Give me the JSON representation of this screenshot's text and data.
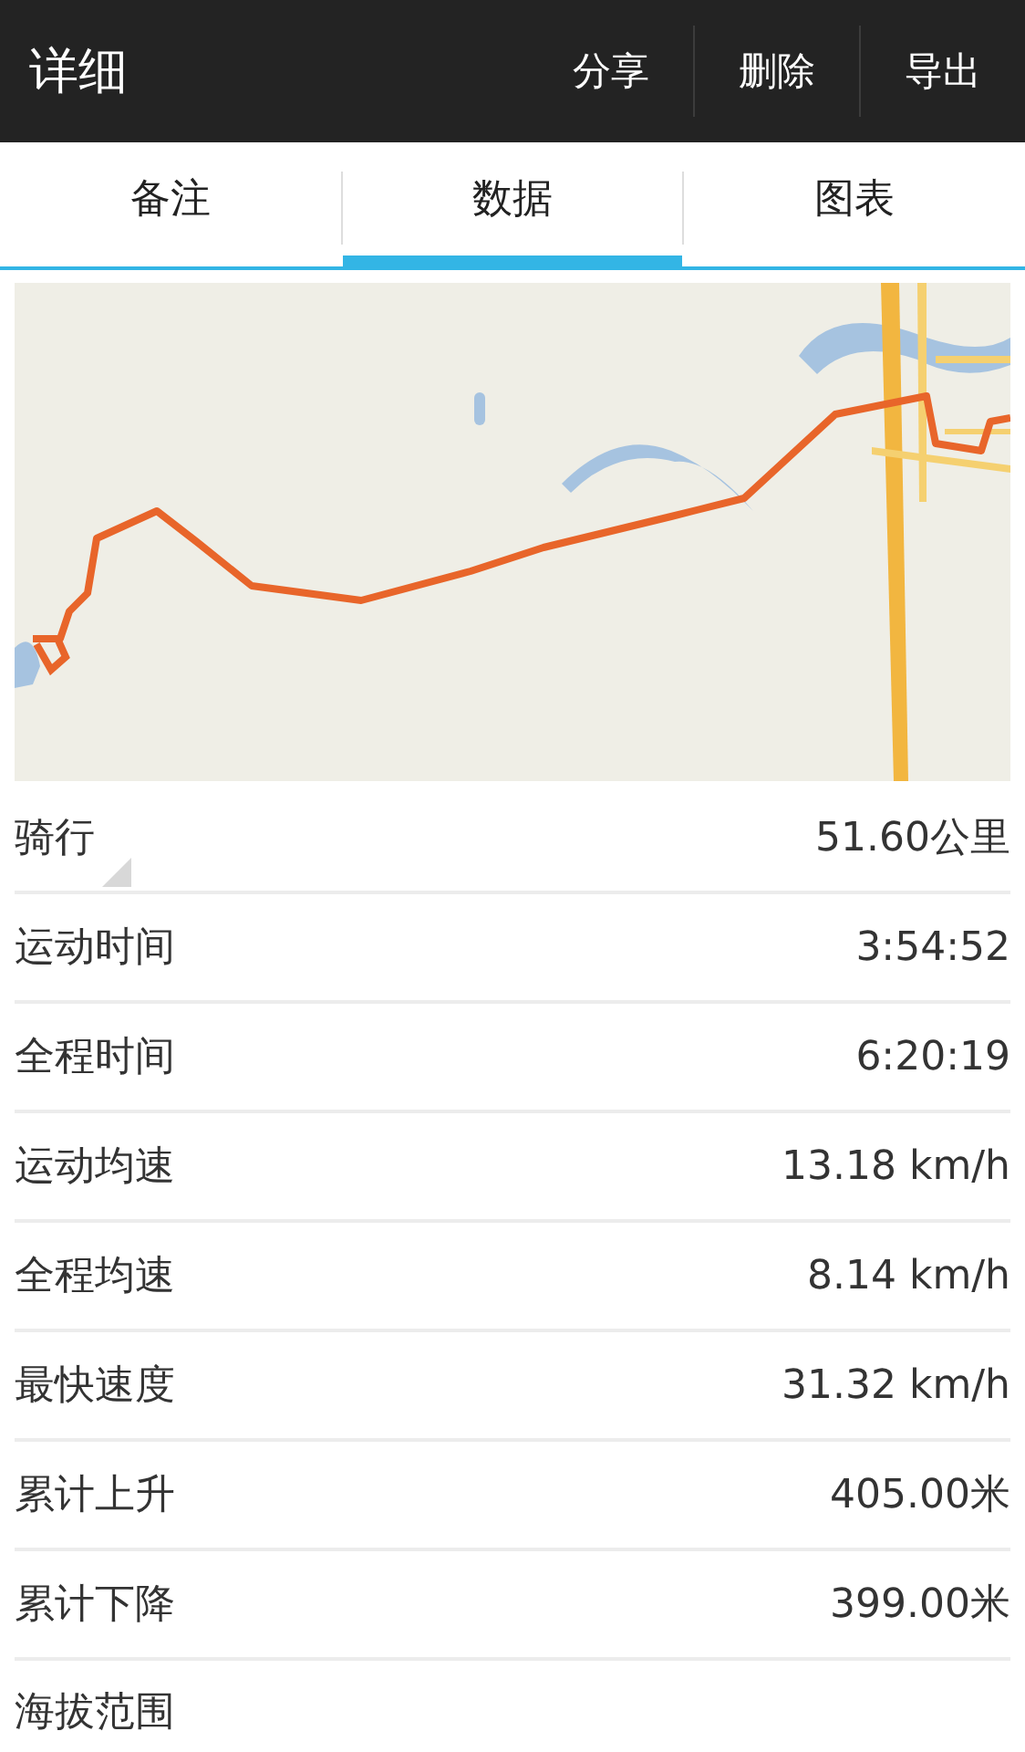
{
  "action_bar": {
    "title": "详细",
    "actions": [
      "分享",
      "删除",
      "导出"
    ]
  },
  "tabs": [
    {
      "label": "备注",
      "selected": false
    },
    {
      "label": "数据",
      "selected": true
    },
    {
      "label": "图表",
      "selected": false
    }
  ],
  "stats": [
    {
      "label": "骑行",
      "value": "51.60公里",
      "dropdown": true
    },
    {
      "label": "运动时间",
      "value": "3:54:52",
      "dropdown": false
    },
    {
      "label": "全程时间",
      "value": "6:20:19",
      "dropdown": false
    },
    {
      "label": "运动均速",
      "value": "13.18 km/h",
      "dropdown": false
    },
    {
      "label": "全程均速",
      "value": "8.14 km/h",
      "dropdown": false
    },
    {
      "label": "最快速度",
      "value": "31.32 km/h",
      "dropdown": false
    },
    {
      "label": "累计上升",
      "value": "405.00米",
      "dropdown": false
    },
    {
      "label": "累计下降",
      "value": "399.00米",
      "dropdown": false
    },
    {
      "label": "海拔范围",
      "dropdown": false
    }
  ]
}
